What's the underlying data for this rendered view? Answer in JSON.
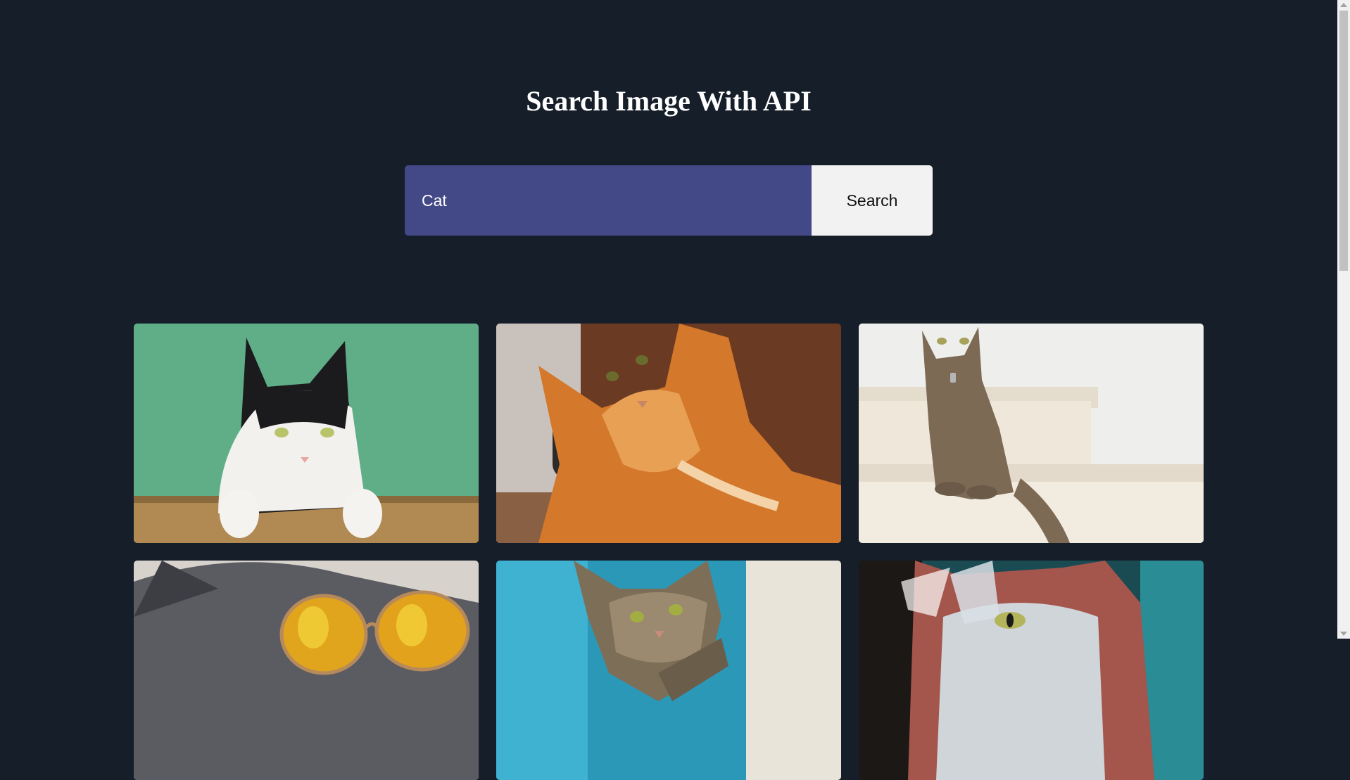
{
  "header": {
    "title": "Search Image With API"
  },
  "search": {
    "value": "Cat",
    "button_label": "Search"
  },
  "results": [
    {
      "name": "cat-image-1"
    },
    {
      "name": "cat-image-2"
    },
    {
      "name": "cat-image-3"
    },
    {
      "name": "cat-image-4"
    },
    {
      "name": "cat-image-5"
    },
    {
      "name": "cat-image-6"
    }
  ],
  "colors": {
    "background": "#151e29",
    "input_bg": "#434887",
    "button_bg": "#f2f2f2"
  }
}
